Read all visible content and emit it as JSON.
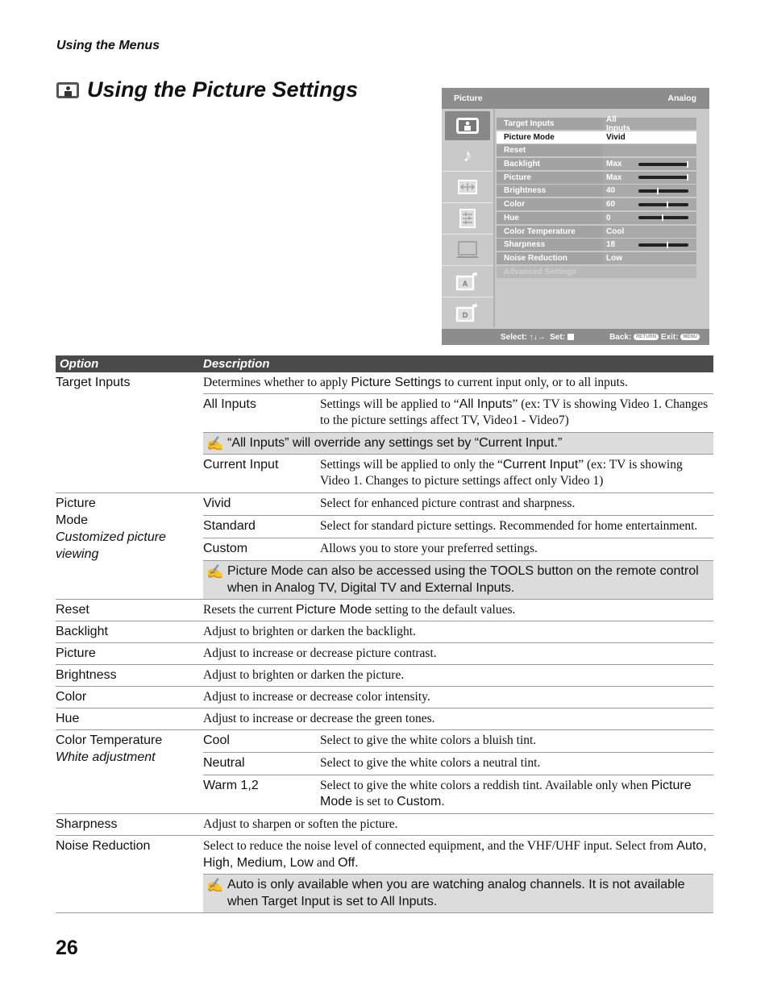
{
  "header": {
    "section_label": "Using the Menus",
    "title": "Using the Picture Settings",
    "title_icon": "picture-settings-icon"
  },
  "tv_menu": {
    "title": "Picture",
    "source": "Analog",
    "categories": [
      {
        "icon": "picture-icon",
        "active": true
      },
      {
        "icon": "sound-icon",
        "active": false
      },
      {
        "icon": "screen-icon",
        "active": false
      },
      {
        "icon": "channel-icon",
        "active": false
      },
      {
        "icon": "setup-icon",
        "active": false
      },
      {
        "icon": "analog-antenna-icon",
        "label": "A",
        "active": false
      },
      {
        "icon": "digital-antenna-icon",
        "label": "D",
        "active": false
      }
    ],
    "rows": [
      {
        "name": "Target Inputs",
        "value": "All Inputs"
      },
      {
        "name": "Picture Mode",
        "value": "Vivid",
        "selected": true
      },
      {
        "name": "Reset",
        "value": ""
      },
      {
        "name": "Backlight",
        "value": "Max",
        "level": 1.0
      },
      {
        "name": "Picture",
        "value": "Max",
        "level": 1.0
      },
      {
        "name": "Brightness",
        "value": "40",
        "level": 0.4
      },
      {
        "name": "Color",
        "value": "60",
        "level": 0.6
      },
      {
        "name": "Hue",
        "value": "0",
        "level": 0.5
      },
      {
        "name": "Color Temperature",
        "value": "Cool"
      },
      {
        "name": "Sharpness",
        "value": "18",
        "level": 0.6
      },
      {
        "name": "Noise Reduction",
        "value": "Low"
      },
      {
        "name": "Advanced Settings",
        "value": "",
        "disabled": true
      }
    ],
    "footer": {
      "select_label": "Select:",
      "select_arrows": "↑↓→",
      "set_label": "Set:",
      "back_label": "Back:",
      "back_button": "RETURN",
      "exit_label": "Exit:",
      "exit_button": "MENU"
    }
  },
  "table": {
    "headers": {
      "option": "Option",
      "description": "Description"
    },
    "target_inputs": {
      "option": "Target Inputs",
      "desc_pre": "Determines whether to apply ",
      "desc_em": "Picture Settings",
      "desc_post": " to current input only, or to all inputs.",
      "all_inputs": {
        "name": "All Inputs",
        "pre": "Settings will be applied to “",
        "em": "All Inputs",
        "post": "” (ex: TV is showing Video 1. Changes to the picture settings affect TV, Video1 - Video7)"
      },
      "note": "“All Inputs” will override any settings set by “Current Input.”",
      "current_input": {
        "name": "Current Input",
        "pre": "Settings will be applied to only the “",
        "em": "Current Input",
        "post": "” (ex: TV is showing Video 1.  Changes to picture settings affect only Video 1)"
      }
    },
    "picture_mode": {
      "option_line1": "Picture",
      "option_line2": "Mode",
      "option_sub": "Customized picture viewing",
      "modes": [
        {
          "name": "Vivid",
          "desc": "Select for enhanced picture contrast and sharpness."
        },
        {
          "name": "Standard",
          "desc": "Select for standard picture settings. Recommended for home entertainment."
        },
        {
          "name": "Custom",
          "desc": "Allows you to store your preferred settings."
        }
      ],
      "note": "Picture Mode can also be accessed using the TOOLS button on the remote control when in Analog TV, Digital TV and External Inputs."
    },
    "reset": {
      "option": "Reset",
      "desc_pre": "Resets the current ",
      "desc_em": "Picture Mode",
      "desc_post": " setting to the default values."
    },
    "simple_rows": [
      {
        "option": "Backlight",
        "desc": "Adjust to brighten or darken the backlight."
      },
      {
        "option": "Picture",
        "desc": "Adjust to increase or decrease picture contrast."
      },
      {
        "option": "Brightness",
        "desc": "Adjust to brighten or darken the picture."
      },
      {
        "option": "Color",
        "desc": "Adjust to increase or decrease color intensity."
      },
      {
        "option": "Hue",
        "desc": "Adjust to increase or decrease the green tones."
      }
    ],
    "color_temperature": {
      "option": "Color Temperature",
      "option_sub": "White adjustment",
      "cool": {
        "name": "Cool",
        "desc": "Select to give the white colors a bluish tint."
      },
      "neutral": {
        "name": "Neutral",
        "desc": "Select to give the white colors a neutral tint."
      },
      "warm": {
        "name": "Warm 1,2",
        "pre": "Select to give the white colors a reddish tint. Available only when ",
        "em1": "Picture Mode",
        "mid": " is set to ",
        "em2": "Custom."
      }
    },
    "sharpness": {
      "option": "Sharpness",
      "desc": "Adjust to sharpen or soften the picture."
    },
    "noise_reduction": {
      "option": "Noise Reduction",
      "desc_pre": "Select to reduce the noise level of connected equipment, and the VHF/UHF input. Select from ",
      "desc_em1": "Auto, High, Medium, Low",
      "desc_mid": " and ",
      "desc_em2": "Off.",
      "note": "Auto is only available when you are watching analog channels. It is not available when Target Input is set to All Inputs."
    }
  },
  "page_number": "26",
  "note_icon": "✍"
}
